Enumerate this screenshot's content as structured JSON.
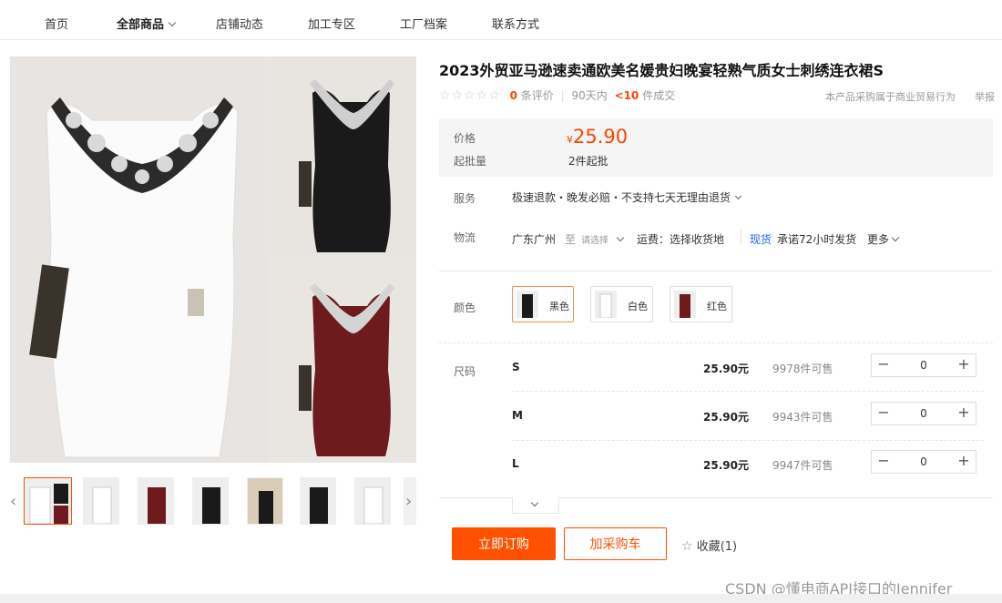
{
  "nav": {
    "tabs": [
      "首页",
      "全部商品",
      "店铺动态",
      "加工专区",
      "工厂档案",
      "联系方式"
    ]
  },
  "product": {
    "title": "2023外贸亚马逊速卖通欧美名媛贵妇晚宴轻熟气质女士刺绣连衣裙S",
    "rating_stars": "☆☆☆☆☆",
    "review_count": "0",
    "review_label": "条评价",
    "sales_period": "90天内",
    "sales_count": "<10",
    "sales_label": "件成交",
    "commerce_note": "本产品采购属于商业贸易行为",
    "report": "举报"
  },
  "pricing": {
    "price_label": "价格",
    "currency": "¥",
    "price": "25.90",
    "moq_label": "起批量",
    "moq": "2件起批"
  },
  "service": {
    "label": "服务",
    "text": "极速退款・晚发必赔・不支持七天无理由退货"
  },
  "logistics": {
    "label": "物流",
    "origin": "广东广州",
    "to": "至",
    "select": "请选择",
    "fee": "运费：选择收货地",
    "stock_tag": "现货",
    "promise": "承诺72小时发货",
    "more": "更多"
  },
  "colors": {
    "label": "颜色",
    "options": [
      "黑色",
      "白色",
      "红色"
    ]
  },
  "sizes": {
    "label": "尺码",
    "rows": [
      {
        "size": "S",
        "price": "25.90元",
        "stock": "9978件可售",
        "qty": "0"
      },
      {
        "size": "M",
        "price": "25.90元",
        "stock": "9943件可售",
        "qty": "0"
      },
      {
        "size": "L",
        "price": "25.90元",
        "stock": "9947件可售",
        "qty": "0"
      }
    ]
  },
  "actions": {
    "buy": "立即订购",
    "cart": "加采购车",
    "favorite": "收藏(1)"
  },
  "watermark": "CSDN @懂电商API接口的Jennifer",
  "colors_hex": {
    "accent": "#ff5000",
    "price": "#ff4400",
    "stock_tag": "#1a66ff"
  }
}
